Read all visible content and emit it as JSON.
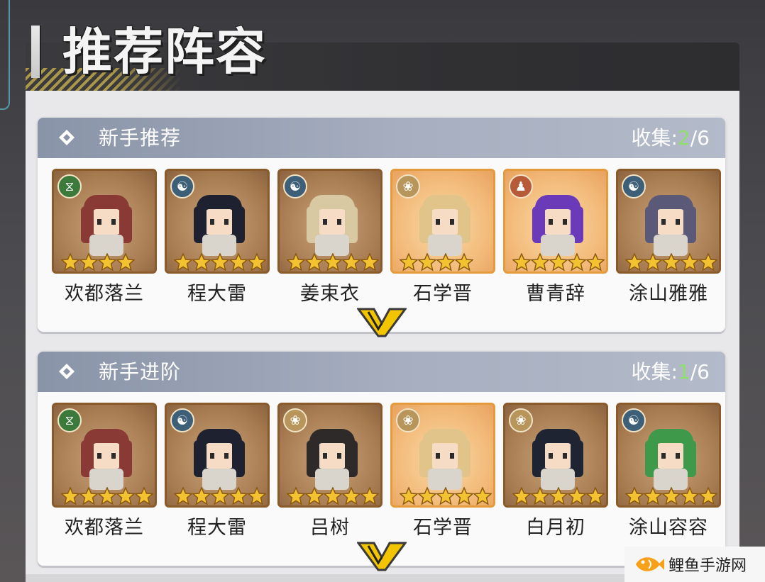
{
  "header": {
    "title": "推荐阵容"
  },
  "sections": [
    {
      "title": "新手推荐",
      "collect_label": "收集:",
      "collect_current": "2",
      "collect_total": "/6",
      "characters": [
        {
          "name": "欢都落兰",
          "badge": "dna-icon",
          "frame": "bronze",
          "stars": 4
        },
        {
          "name": "程大雷",
          "badge": "yinyang-icon",
          "frame": "bronze",
          "stars": 5
        },
        {
          "name": "姜束衣",
          "badge": "yinyang-icon",
          "frame": "bronze",
          "stars": 5
        },
        {
          "name": "石学晋",
          "badge": "lotus-icon",
          "frame": "gold",
          "stars": 4
        },
        {
          "name": "曹青辞",
          "badge": "meditation-icon",
          "frame": "gold",
          "stars": 5
        },
        {
          "name": "涂山雅雅",
          "badge": "yinyang-icon",
          "frame": "bronze",
          "stars": 5
        }
      ]
    },
    {
      "title": "新手进阶",
      "collect_label": "收集:",
      "collect_current": "1",
      "collect_total": "/6",
      "characters": [
        {
          "name": "欢都落兰",
          "badge": "dna-icon",
          "frame": "bronze",
          "stars": 5
        },
        {
          "name": "程大雷",
          "badge": "yinyang-icon",
          "frame": "bronze",
          "stars": 5
        },
        {
          "name": "吕树",
          "badge": "lotus-icon",
          "frame": "bronze",
          "stars": 5
        },
        {
          "name": "石学晋",
          "badge": "lotus-icon",
          "frame": "gold",
          "stars": 5
        },
        {
          "name": "白月初",
          "badge": "lotus-icon",
          "frame": "bronze",
          "stars": 5
        },
        {
          "name": "涂山容容",
          "badge": "yinyang-icon",
          "frame": "bronze",
          "stars": 5
        }
      ]
    }
  ],
  "watermark": {
    "text": "鲤鱼手游网"
  },
  "colors": {
    "accent_green": "#8ee06a",
    "header_bg": "#303033",
    "section_head": "#a7afc0",
    "star_fill": "#f2c230",
    "expand_yellow": "#f3c400"
  }
}
